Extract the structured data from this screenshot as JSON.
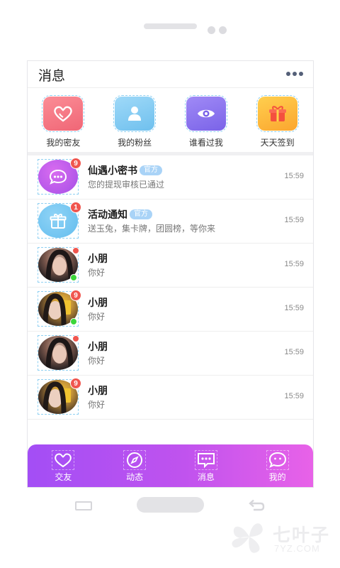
{
  "header": {
    "title": "消息"
  },
  "quick_actions": [
    {
      "label": "我的密友",
      "icon": "heart-icon",
      "color": "#f5707d"
    },
    {
      "label": "我的粉丝",
      "icon": "person-icon",
      "color": "#86cdf4"
    },
    {
      "label": "谁看过我",
      "icon": "eye-icon",
      "color": "#8a72f0"
    },
    {
      "label": "天天签到",
      "icon": "gift-box-icon",
      "color": "#fdb93a"
    }
  ],
  "messages": [
    {
      "name": "仙遇小密书",
      "tag": "官方",
      "preview": "您的提现审核已通过",
      "time": "15:59",
      "badge": "9"
    },
    {
      "name": "活动通知",
      "tag": "官方",
      "preview": "送玉兔，集卡牌，团圆榜，等你来",
      "time": "15:59",
      "badge": "1"
    },
    {
      "name": "小朋",
      "preview": "你好",
      "time": "15:59"
    },
    {
      "name": "小朋",
      "preview": "你好",
      "time": "15:59",
      "badge": "9"
    },
    {
      "name": "小朋",
      "preview": "你好",
      "time": "15:59"
    },
    {
      "name": "小朋",
      "preview": "你好",
      "time": "15:59",
      "badge": "9"
    }
  ],
  "tabbar": [
    {
      "label": "交友",
      "icon": "heart-outline-icon"
    },
    {
      "label": "动态",
      "icon": "compass-icon"
    },
    {
      "label": "消息",
      "icon": "chat-bubble-icon"
    },
    {
      "label": "我的",
      "icon": "smile-bubble-icon"
    }
  ],
  "watermark": {
    "text": "七叶子",
    "sub": "7YZ.COM"
  },
  "colors": {
    "accent_start": "#a34ef5",
    "accent_end": "#e862e8",
    "badge": "#f0564f",
    "online": "#3ad63a"
  }
}
